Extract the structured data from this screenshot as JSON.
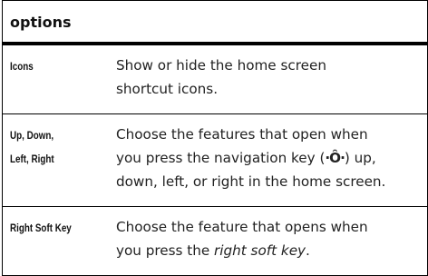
{
  "table": {
    "header": "options",
    "rows": [
      {
        "term_lines": [
          "Icons"
        ],
        "desc_lines": [
          "Show or hide the home screen",
          "shortcut icons."
        ]
      },
      {
        "term_lines": [
          "Up, Down,",
          "Left, Right"
        ],
        "desc_line1": "Choose the features that open when",
        "desc_line2_pre": "you press the navigation key (",
        "nav_glyph": "·Ô·",
        "desc_line2_post": ") up,",
        "desc_line3": "down, left, or right in the home screen."
      },
      {
        "term_lines": [
          "Right Soft Key"
        ],
        "desc_line1": "Choose the feature that opens when",
        "desc_line2_pre": "you press the ",
        "desc_line2_em": "right soft key",
        "desc_line2_post": "."
      }
    ]
  }
}
